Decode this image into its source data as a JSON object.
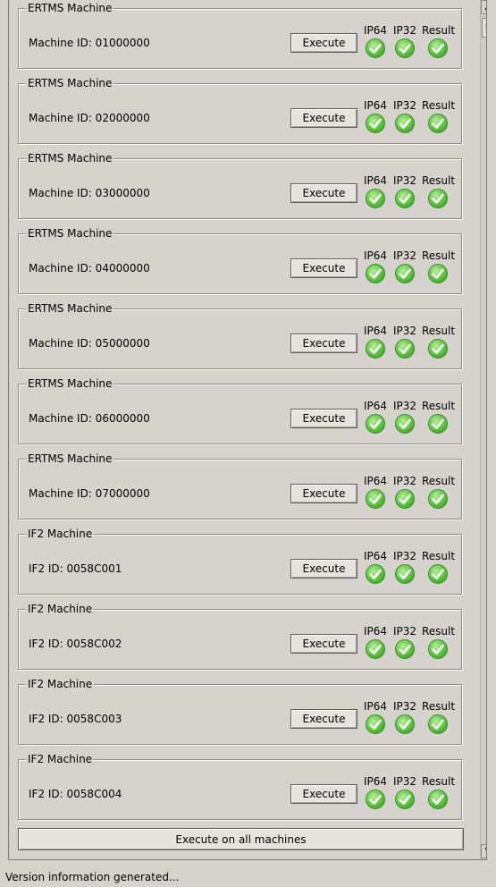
{
  "status_labels": {
    "ip64": "IP64",
    "ip32": "IP32",
    "result": "Result"
  },
  "execute_label": "Execute",
  "machines": [
    {
      "title": "ERTMS Machine",
      "id_text": "Machine ID: 01000000",
      "ip64": "passed",
      "ip32": "passed",
      "result": "passed"
    },
    {
      "title": "ERTMS Machine",
      "id_text": "Machine ID: 02000000",
      "ip64": "passed",
      "ip32": "passed",
      "result": "passed"
    },
    {
      "title": "ERTMS Machine",
      "id_text": "Machine ID: 03000000",
      "ip64": "passed",
      "ip32": "passed",
      "result": "passed"
    },
    {
      "title": "ERTMS Machine",
      "id_text": "Machine ID: 04000000",
      "ip64": "passed",
      "ip32": "passed",
      "result": "passed"
    },
    {
      "title": "ERTMS Machine",
      "id_text": "Machine ID: 05000000",
      "ip64": "passed",
      "ip32": "passed",
      "result": "passed"
    },
    {
      "title": "ERTMS Machine",
      "id_text": "Machine ID: 06000000",
      "ip64": "passed",
      "ip32": "passed",
      "result": "passed"
    },
    {
      "title": "ERTMS Machine",
      "id_text": "Machine ID: 07000000",
      "ip64": "passed",
      "ip32": "passed",
      "result": "passed"
    },
    {
      "title": "IF2 Machine",
      "id_text": "IF2 ID: 0058C001",
      "ip64": "passed",
      "ip32": "passed",
      "result": "passed"
    },
    {
      "title": "IF2 Machine",
      "id_text": "IF2 ID: 0058C002",
      "ip64": "passed",
      "ip32": "passed",
      "result": "passed"
    },
    {
      "title": "IF2 Machine",
      "id_text": "IF2 ID: 0058C003",
      "ip64": "passed",
      "ip32": "passed",
      "result": "passed"
    },
    {
      "title": "IF2 Machine",
      "id_text": "IF2 ID: 0058C004",
      "ip64": "passed",
      "ip32": "passed",
      "result": "passed"
    }
  ],
  "execute_all_label": "Execute on all machines",
  "status_bar_text": "Version information generated...",
  "icons": {
    "status": "check-circle-icon",
    "scroll_up": "arrow-up-icon",
    "scroll_down": "arrow-down-icon"
  },
  "colors": {
    "window_bg": "#d6d3ce",
    "check_green": "#58c23a"
  }
}
